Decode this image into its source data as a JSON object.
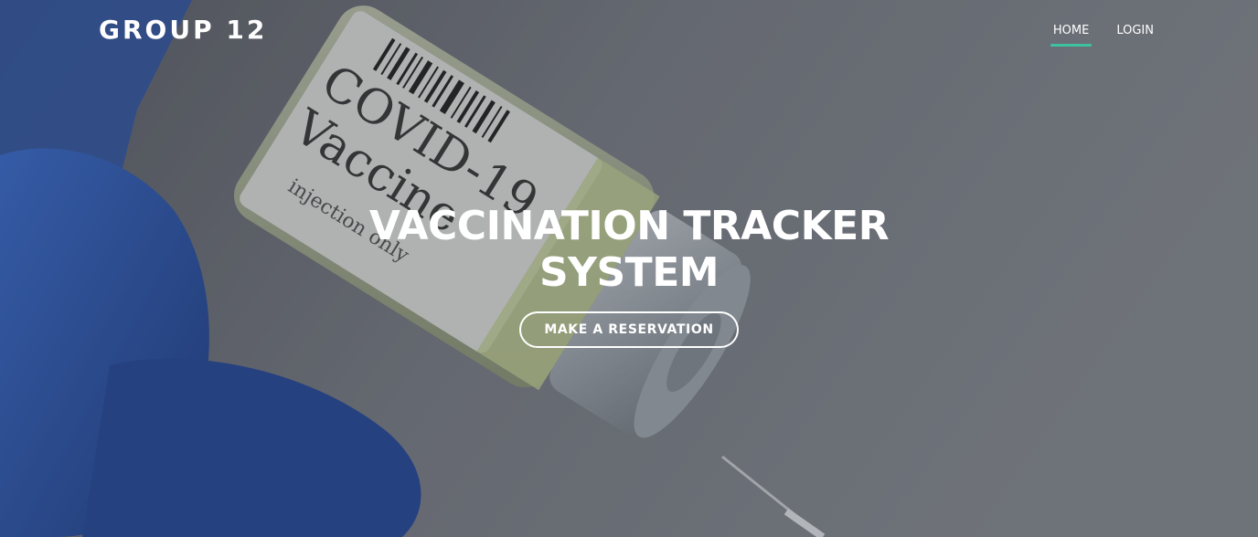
{
  "brand": {
    "name": "GROUP 12"
  },
  "nav": {
    "items": [
      {
        "label": "HOME",
        "active": true
      },
      {
        "label": "LOGIN",
        "active": false
      }
    ]
  },
  "hero": {
    "title": "VACCINATION TRACKER SYSTEM",
    "cta_label": "MAKE A RESERVATION",
    "vial_label_line1": "COVID-19",
    "vial_label_line2": "Vaccine",
    "vial_label_line3": "injection only"
  },
  "colors": {
    "accent": "#3ec1a0",
    "glove": "#2f62c8",
    "background": "#6a7078"
  }
}
